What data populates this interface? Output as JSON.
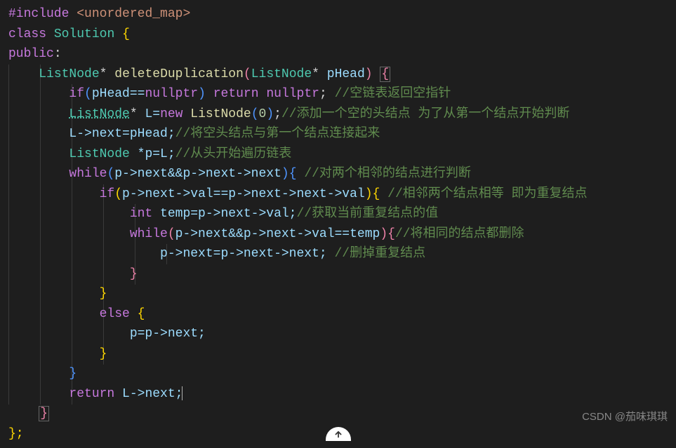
{
  "code": {
    "l1": {
      "include": "#include",
      "header": "<unordered_map>"
    },
    "l2": {
      "class": "class",
      "name": "Solution",
      "brace": "{"
    },
    "l3": {
      "public": "public",
      "colon": ":"
    },
    "l4": {
      "type": "ListNode",
      "ptr": "*",
      "func": "deleteDuplication",
      "po": "(",
      "ptype": "ListNode",
      "pptr": "*",
      "pname": "pHead",
      "pc": ")",
      "brace": "{"
    },
    "l5": {
      "if": "if",
      "po": "(",
      "cond": "pHead==",
      "null": "nullptr",
      "pc": ")",
      "ret": "return",
      "null2": "nullptr",
      "semi": ";",
      "comment": "//空链表返回空指针"
    },
    "l6": {
      "type": "ListNode",
      "ptr": "*",
      "var": "L=",
      "new": "new",
      "ctor": "ListNode",
      "po": "(",
      "num": "0",
      "pc": ")",
      "semi": ";",
      "comment": "//添加一个空的头结点 为了从第一个结点开始判断"
    },
    "l7": {
      "expr": "L->next=pHead;",
      "comment": "//将空头结点与第一个结点连接起来"
    },
    "l8": {
      "type": "ListNode",
      "rest": " *p=L;",
      "comment": "//从头开始遍历链表"
    },
    "l9": {
      "while": "while",
      "po": "(",
      "cond": "p->next&&p->next->next",
      "pc": ")",
      "brace": "{",
      "comment": "//对两个相邻的结点进行判断"
    },
    "l10": {
      "if": "if",
      "po": "(",
      "cond": "p->next->val==p->next->next->val",
      "pc": ")",
      "brace": "{",
      "comment": "//相邻两个结点相等 即为重复结点"
    },
    "l11": {
      "type": "int",
      "rest": " temp=p->next->val;",
      "comment": "//获取当前重复结点的值"
    },
    "l12": {
      "while": "while",
      "po": "(",
      "cond": "p->next&&p->next->val==temp",
      "pc": ")",
      "brace": "{",
      "comment": "//将相同的结点都删除"
    },
    "l13": {
      "expr": "p->next=p->next->next;",
      "comment": "//删掉重复结点"
    },
    "l14": {
      "brace": "}"
    },
    "l15": {
      "brace": "}"
    },
    "l16": {
      "else": "else",
      "brace": "{"
    },
    "l17": {
      "expr": "p=p->next;"
    },
    "l18": {
      "brace": "}"
    },
    "l19": {
      "brace": "}"
    },
    "l20": {
      "ret": "return",
      "expr": " L->next;"
    },
    "l21": {
      "brace": "}"
    },
    "l22": {
      "brace": "};"
    }
  },
  "watermark": "CSDN @茄味琪琪"
}
